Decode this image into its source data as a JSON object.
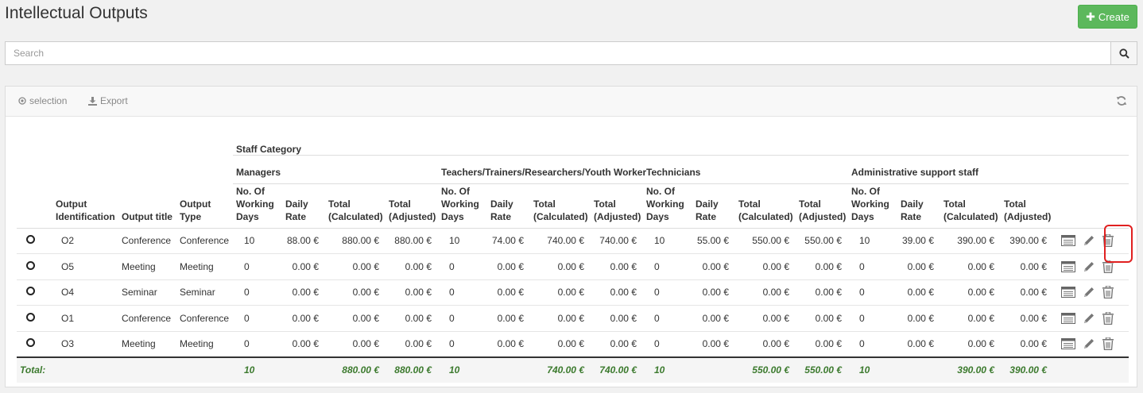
{
  "page": {
    "title": "Intellectual Outputs"
  },
  "toolbar": {
    "create_label": "Create"
  },
  "search": {
    "placeholder": "Search"
  },
  "panel": {
    "selection_label": "selection",
    "export_label": "Export"
  },
  "table": {
    "staff_category": "Staff Category",
    "groups": [
      "Managers",
      "Teachers/Trainers/Researchers/Youth Worker",
      "Technicians",
      "Administrative support staff"
    ],
    "base_columns": [
      "Output Identification",
      "Output title",
      "Output Type"
    ],
    "group_columns": [
      "No. Of Working Days",
      "Daily Rate",
      "Total (Calculated)",
      "Total (Adjusted)"
    ],
    "rows": [
      {
        "id": "O2",
        "title": "Conference",
        "type": "Conference",
        "cells": [
          "10",
          "88.00 €",
          "880.00 €",
          "880.00 €",
          "10",
          "74.00 €",
          "740.00 €",
          "740.00 €",
          "10",
          "55.00 €",
          "550.00 €",
          "550.00 €",
          "10",
          "39.00 €",
          "390.00 €",
          "390.00 €"
        ]
      },
      {
        "id": "O5",
        "title": "Meeting",
        "type": "Meeting",
        "cells": [
          "0",
          "0.00 €",
          "0.00 €",
          "0.00 €",
          "0",
          "0.00 €",
          "0.00 €",
          "0.00 €",
          "0",
          "0.00 €",
          "0.00 €",
          "0.00 €",
          "0",
          "0.00 €",
          "0.00 €",
          "0.00 €"
        ]
      },
      {
        "id": "O4",
        "title": "Seminar",
        "type": "Seminar",
        "cells": [
          "0",
          "0.00 €",
          "0.00 €",
          "0.00 €",
          "0",
          "0.00 €",
          "0.00 €",
          "0.00 €",
          "0",
          "0.00 €",
          "0.00 €",
          "0.00 €",
          "0",
          "0.00 €",
          "0.00 €",
          "0.00 €"
        ]
      },
      {
        "id": "O1",
        "title": "Conference",
        "type": "Conference",
        "cells": [
          "0",
          "0.00 €",
          "0.00 €",
          "0.00 €",
          "0",
          "0.00 €",
          "0.00 €",
          "0.00 €",
          "0",
          "0.00 €",
          "0.00 €",
          "0.00 €",
          "0",
          "0.00 €",
          "0.00 €",
          "0.00 €"
        ]
      },
      {
        "id": "O3",
        "title": "Meeting",
        "type": "Meeting",
        "cells": [
          "0",
          "0.00 €",
          "0.00 €",
          "0.00 €",
          "0",
          "0.00 €",
          "0.00 €",
          "0.00 €",
          "0",
          "0.00 €",
          "0.00 €",
          "0.00 €",
          "0",
          "0.00 €",
          "0.00 €",
          "0.00 €"
        ]
      }
    ],
    "footer": {
      "label": "Total:",
      "cells": [
        "10",
        "",
        "880.00 €",
        "880.00 €",
        "10",
        "",
        "740.00 €",
        "740.00 €",
        "10",
        "",
        "550.00 €",
        "550.00 €",
        "10",
        "",
        "390.00 €",
        "390.00 €"
      ]
    }
  },
  "colors": {
    "create_bg": "#5cb85c",
    "total_text": "#3c7a2e",
    "highlight": "#e02020"
  },
  "icons": {
    "row_actions": [
      "details-icon",
      "edit-pencil-icon",
      "delete-trash-icon"
    ]
  }
}
